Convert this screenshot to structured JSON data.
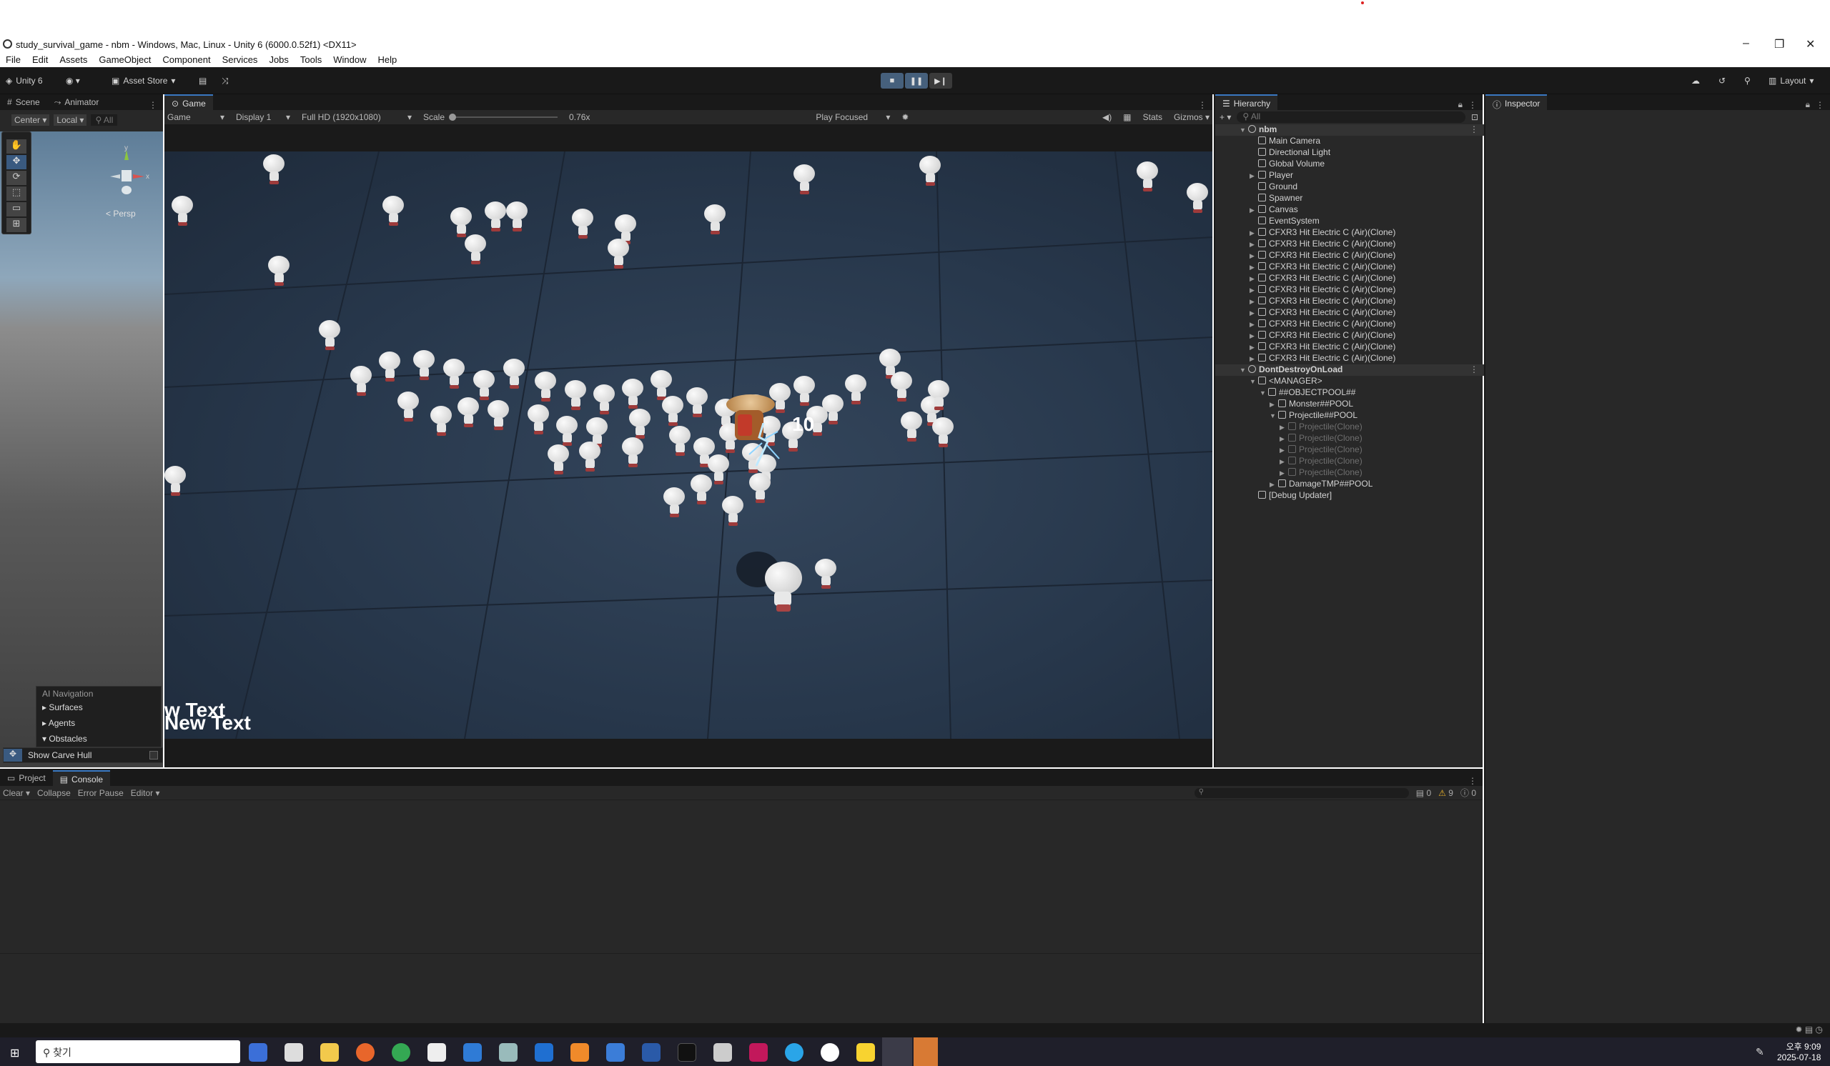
{
  "window": {
    "title": "study_survival_game - nbm - Windows, Mac, Linux - Unity 6 (6000.0.52f1) <DX11>"
  },
  "menu": [
    "File",
    "Edit",
    "Assets",
    "GameObject",
    "Component",
    "Services",
    "Jobs",
    "Tools",
    "Window",
    "Help"
  ],
  "toolbar": {
    "account": "Unity 6",
    "asset_store": "Asset Store",
    "layout": "Layout"
  },
  "scene_panel": {
    "tabs": [
      "Scene",
      "Animator"
    ],
    "pivot": "Center",
    "space": "Local",
    "search_hint": "All",
    "persp_label": "< Persp",
    "gizmo_y": "y",
    "gizmo_x": "x"
  },
  "ai_nav": {
    "title": "AI Navigation",
    "items": [
      "Surfaces",
      "Agents",
      "Obstacles"
    ],
    "show_carve": "Show Carve Hull"
  },
  "game_panel": {
    "tab": "Game",
    "mode": "Game",
    "display": "Display 1",
    "resolution": "Full HD (1920x1080)",
    "scale_label": "Scale",
    "scale_value": "0.76x",
    "play_focused": "Play Focused",
    "stats": "Stats",
    "gizmos": "Gizmos",
    "damage_text": "10",
    "ui_text_1": "w Text",
    "ui_text_2": "New Text"
  },
  "hierarchy": {
    "tab": "Hierarchy",
    "search_hint": "All",
    "rows": [
      {
        "label": "nbm",
        "indent": 0,
        "arrow": "▼",
        "kind": "scene"
      },
      {
        "label": "Main Camera",
        "indent": 1,
        "arrow": "",
        "kind": "obj"
      },
      {
        "label": "Directional Light",
        "indent": 1,
        "arrow": "",
        "kind": "obj"
      },
      {
        "label": "Global Volume",
        "indent": 1,
        "arrow": "",
        "kind": "obj"
      },
      {
        "label": "Player",
        "indent": 1,
        "arrow": "▶",
        "kind": "obj"
      },
      {
        "label": "Ground",
        "indent": 1,
        "arrow": "",
        "kind": "obj"
      },
      {
        "label": "Spawner",
        "indent": 1,
        "arrow": "",
        "kind": "obj"
      },
      {
        "label": "Canvas",
        "indent": 1,
        "arrow": "▶",
        "kind": "obj"
      },
      {
        "label": "EventSystem",
        "indent": 1,
        "arrow": "",
        "kind": "obj"
      },
      {
        "label": "CFXR3 Hit Electric C (Air)(Clone)",
        "indent": 1,
        "arrow": "▶",
        "kind": "obj"
      },
      {
        "label": "CFXR3 Hit Electric C (Air)(Clone)",
        "indent": 1,
        "arrow": "▶",
        "kind": "obj"
      },
      {
        "label": "CFXR3 Hit Electric C (Air)(Clone)",
        "indent": 1,
        "arrow": "▶",
        "kind": "obj"
      },
      {
        "label": "CFXR3 Hit Electric C (Air)(Clone)",
        "indent": 1,
        "arrow": "▶",
        "kind": "obj"
      },
      {
        "label": "CFXR3 Hit Electric C (Air)(Clone)",
        "indent": 1,
        "arrow": "▶",
        "kind": "obj"
      },
      {
        "label": "CFXR3 Hit Electric C (Air)(Clone)",
        "indent": 1,
        "arrow": "▶",
        "kind": "obj"
      },
      {
        "label": "CFXR3 Hit Electric C (Air)(Clone)",
        "indent": 1,
        "arrow": "▶",
        "kind": "obj"
      },
      {
        "label": "CFXR3 Hit Electric C (Air)(Clone)",
        "indent": 1,
        "arrow": "▶",
        "kind": "obj"
      },
      {
        "label": "CFXR3 Hit Electric C (Air)(Clone)",
        "indent": 1,
        "arrow": "▶",
        "kind": "obj"
      },
      {
        "label": "CFXR3 Hit Electric C (Air)(Clone)",
        "indent": 1,
        "arrow": "▶",
        "kind": "obj"
      },
      {
        "label": "CFXR3 Hit Electric C (Air)(Clone)",
        "indent": 1,
        "arrow": "▶",
        "kind": "obj"
      },
      {
        "label": "CFXR3 Hit Electric C (Air)(Clone)",
        "indent": 1,
        "arrow": "▶",
        "kind": "obj"
      },
      {
        "label": "DontDestroyOnLoad",
        "indent": 0,
        "arrow": "▼",
        "kind": "scene"
      },
      {
        "label": "<MANAGER>",
        "indent": 1,
        "arrow": "▼",
        "kind": "obj"
      },
      {
        "label": "##OBJECTPOOL##",
        "indent": 2,
        "arrow": "▼",
        "kind": "obj"
      },
      {
        "label": "Monster##POOL",
        "indent": 3,
        "arrow": "▶",
        "kind": "obj"
      },
      {
        "label": "Projectile##POOL",
        "indent": 3,
        "arrow": "▼",
        "kind": "obj"
      },
      {
        "label": "Projectile(Clone)",
        "indent": 4,
        "arrow": "▶",
        "kind": "dim"
      },
      {
        "label": "Projectile(Clone)",
        "indent": 4,
        "arrow": "▶",
        "kind": "dim"
      },
      {
        "label": "Projectile(Clone)",
        "indent": 4,
        "arrow": "▶",
        "kind": "dim"
      },
      {
        "label": "Projectile(Clone)",
        "indent": 4,
        "arrow": "▶",
        "kind": "dim"
      },
      {
        "label": "Projectile(Clone)",
        "indent": 4,
        "arrow": "▶",
        "kind": "dim"
      },
      {
        "label": "DamageTMP##POOL",
        "indent": 3,
        "arrow": "▶",
        "kind": "obj"
      },
      {
        "label": "[Debug Updater]",
        "indent": 1,
        "arrow": "",
        "kind": "obj"
      }
    ]
  },
  "inspector": {
    "tab": "Inspector"
  },
  "bottom_panel": {
    "tabs": [
      "Project",
      "Console"
    ],
    "clear": "Clear",
    "collapse": "Collapse",
    "error_pause": "Error Pause",
    "editor": "Editor",
    "count_logs": "0",
    "count_warnings": "9",
    "count_errors": "0"
  },
  "taskbar": {
    "search_placeholder": "찾기",
    "time": "오후 9:09",
    "date": "2025-07-18"
  },
  "colors": {
    "accent": "#3a78c2",
    "editor_bg": "#282828",
    "dark_bg": "#191919"
  }
}
